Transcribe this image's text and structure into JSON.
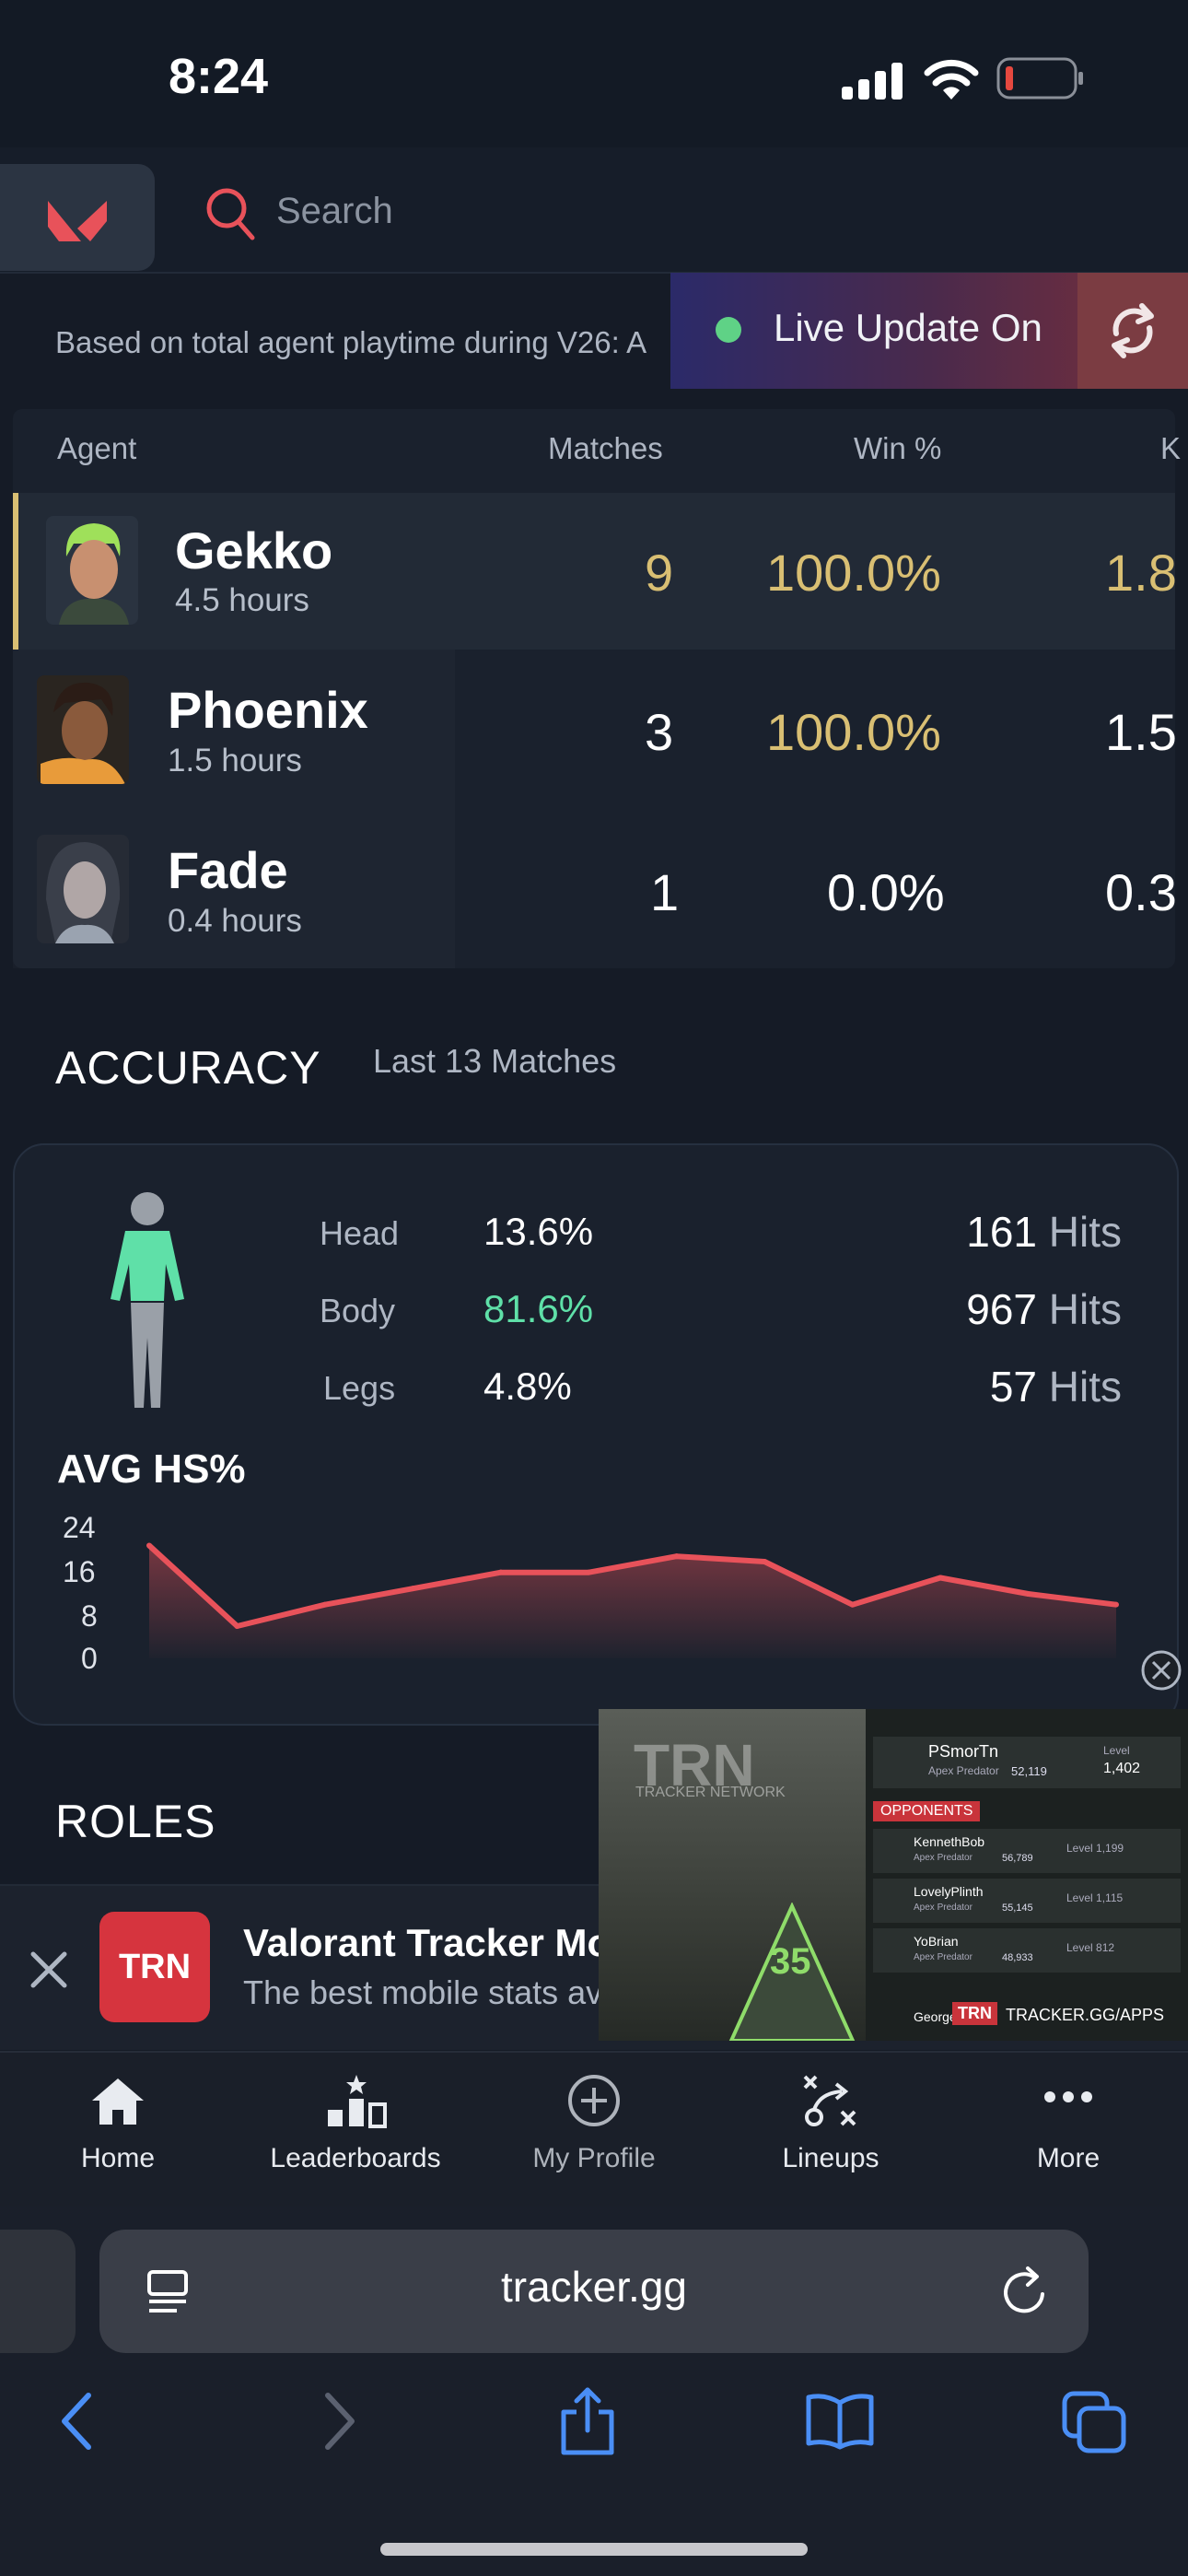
{
  "status_bar": {
    "time": "8:24"
  },
  "header": {
    "search_placeholder": "Search"
  },
  "notice": {
    "text": "Based on total agent playtime during V26: A"
  },
  "live_update": {
    "label": "Live Update On"
  },
  "agents_table": {
    "columns": [
      "Agent",
      "Matches",
      "Win %",
      "K"
    ],
    "rows": [
      {
        "agent": "Gekko",
        "hours": "4.5 hours",
        "matches": "9",
        "win": "100.0%",
        "kd": "1.8"
      },
      {
        "agent": "Phoenix",
        "hours": "1.5 hours",
        "matches": "3",
        "win": "100.0%",
        "kd": "1.5"
      },
      {
        "agent": "Fade",
        "hours": "0.4 hours",
        "matches": "1",
        "win": "0.0%",
        "kd": "0.3"
      }
    ]
  },
  "accuracy": {
    "title": "ACCURACY",
    "subtitle": "Last 13 Matches",
    "rows": [
      {
        "label": "Head",
        "pct": "13.6%",
        "hits": "161",
        "hits_word": "Hits"
      },
      {
        "label": "Body",
        "pct": "81.6%",
        "hits": "967",
        "hits_word": "Hits"
      },
      {
        "label": "Legs",
        "pct": "4.8%",
        "hits": "57",
        "hits_word": "Hits"
      }
    ],
    "highlight_color": "#5fe0a8"
  },
  "chart_data": {
    "type": "area",
    "title": "AVG HS%",
    "xlabel": "",
    "ylabel": "",
    "yticks": [
      "24",
      "16",
      "8",
      "0"
    ],
    "ylim": [
      0,
      24
    ],
    "series": [
      {
        "values": [
          21,
          6,
          10,
          13,
          16,
          16,
          19,
          18,
          10,
          15,
          12,
          10
        ]
      }
    ],
    "color": "#e8525a"
  },
  "roles": {
    "title": "ROLES"
  },
  "banner": {
    "logo_text": "TRN",
    "title": "Valorant Tracker Mo",
    "subtitle": "The best mobile stats av"
  },
  "video_ad": {
    "watermark": "TRACKER NETWORK",
    "trn_logo_text": "TRN",
    "footer": "TRACKER.GG/APPS",
    "badge_number": "35",
    "top_player": {
      "name": "PSmorTn",
      "rank": "Apex Predator",
      "score": "52,119",
      "level_label": "Level",
      "level": "1,402"
    },
    "opponents_label": "OPPONENTS",
    "opponents": [
      {
        "name": "KennethBob",
        "rank": "Apex Predator",
        "score": "56,789",
        "level": "Level 1,199"
      },
      {
        "name": "LovelyPlinth",
        "rank": "Apex Predator",
        "score": "55,145",
        "level": "Level 1,115"
      },
      {
        "name": "YoBrian",
        "rank": "Apex Predator",
        "score": "48,933",
        "level": "Level 812"
      },
      {
        "name": "George",
        "rank": "",
        "score": "",
        "level": ""
      }
    ]
  },
  "bottom_nav": {
    "items": [
      {
        "label": "Home"
      },
      {
        "label": "Leaderboards"
      },
      {
        "label": "My Profile"
      },
      {
        "label": "Lineups"
      },
      {
        "label": "More"
      }
    ]
  },
  "browser": {
    "url": "tracker.gg"
  }
}
